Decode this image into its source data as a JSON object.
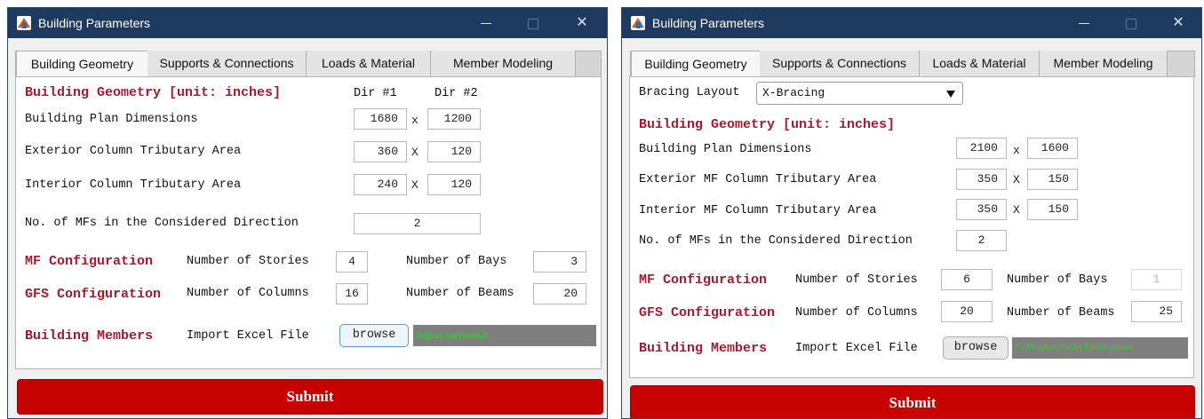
{
  "colors": {
    "titlebar": "#1f3a5f",
    "section_header": "#a6192e",
    "submit": "#c70000",
    "status_text": "#29d829",
    "status_bg": "#7f7f7f"
  },
  "windows": [
    {
      "title": "Building Parameters",
      "tabs": [
        {
          "label": "Building Geometry",
          "active": true
        },
        {
          "label": "Supports & Connections",
          "active": false
        },
        {
          "label": "Loads & Material",
          "active": false
        },
        {
          "label": "Member Modeling",
          "active": false
        }
      ],
      "geometry_header": "Building Geometry [unit: inches]",
      "dir1_label": "Dir #1",
      "dir2_label": "Dir #2",
      "plan_label": "Building Plan Dimensions",
      "plan_dir1": "1680",
      "plan_dir2": "1200",
      "ext_label": "Exterior Column Tributary Area",
      "ext_dir1": "360",
      "ext_dir2": "120",
      "int_label": "Interior Column Tributary Area",
      "int_dir1": "240",
      "int_dir2": "120",
      "x_sep": "X",
      "x_sep_lower": "x",
      "mfs_label": "No. of MFs in the Considered Direction",
      "mfs_value": "2",
      "mf_header": "MF Configuration",
      "stories_label": "Number of Stories",
      "stories_value": "4",
      "bays_label": "Number of Bays",
      "bays_value": "3",
      "gfs_header": "GFS Configuration",
      "columns_label": "Number of Columns",
      "columns_value": "16",
      "beams_label": "Number of Beams",
      "beams_value": "20",
      "members_header": "Building Members",
      "import_label": "Import Excel File",
      "browse_label": "browse",
      "status_text": "Import successful!",
      "submit_label": "Submit"
    },
    {
      "title": "Building Parameters",
      "tabs": [
        {
          "label": "Building Geometry",
          "active": true
        },
        {
          "label": "Supports & Connections",
          "active": false
        },
        {
          "label": "Loads & Material",
          "active": false
        },
        {
          "label": "Member Modeling",
          "active": false
        }
      ],
      "bracing_label": "Bracing Layout",
      "bracing_value": "X-Bracing",
      "geometry_header": "Building Geometry [unit: inches]",
      "plan_label": "Building Plan Dimensions",
      "plan_dir1": "2100",
      "plan_dir2": "1600",
      "ext_label": "Exterior MF Column Tributary Area",
      "ext_dir1": "350",
      "ext_dir2": "150",
      "int_label": "Interior MF Column Tributary Area",
      "int_dir1": "350",
      "int_dir2": "150",
      "x_sep": "X",
      "x_sep_lower": "x",
      "mfs_label": "No. of MFs in the Considered Direction",
      "mfs_value": "2",
      "mf_header": "MF Configuration",
      "stories_label": "Number of Stories",
      "stories_value": "6",
      "bays_label": "Number of Bays",
      "bays_value": "1",
      "gfs_header": "GFS Configuration",
      "columns_label": "Number of Columns",
      "columns_value": "20",
      "beams_label": "Number of Beams",
      "beams_value": "25",
      "members_header": "Building Members",
      "import_label": "Import Excel File",
      "browse_label": "browse",
      "status_text": "C:\\Dropbox\\Under Development",
      "submit_label": "Submit"
    }
  ]
}
